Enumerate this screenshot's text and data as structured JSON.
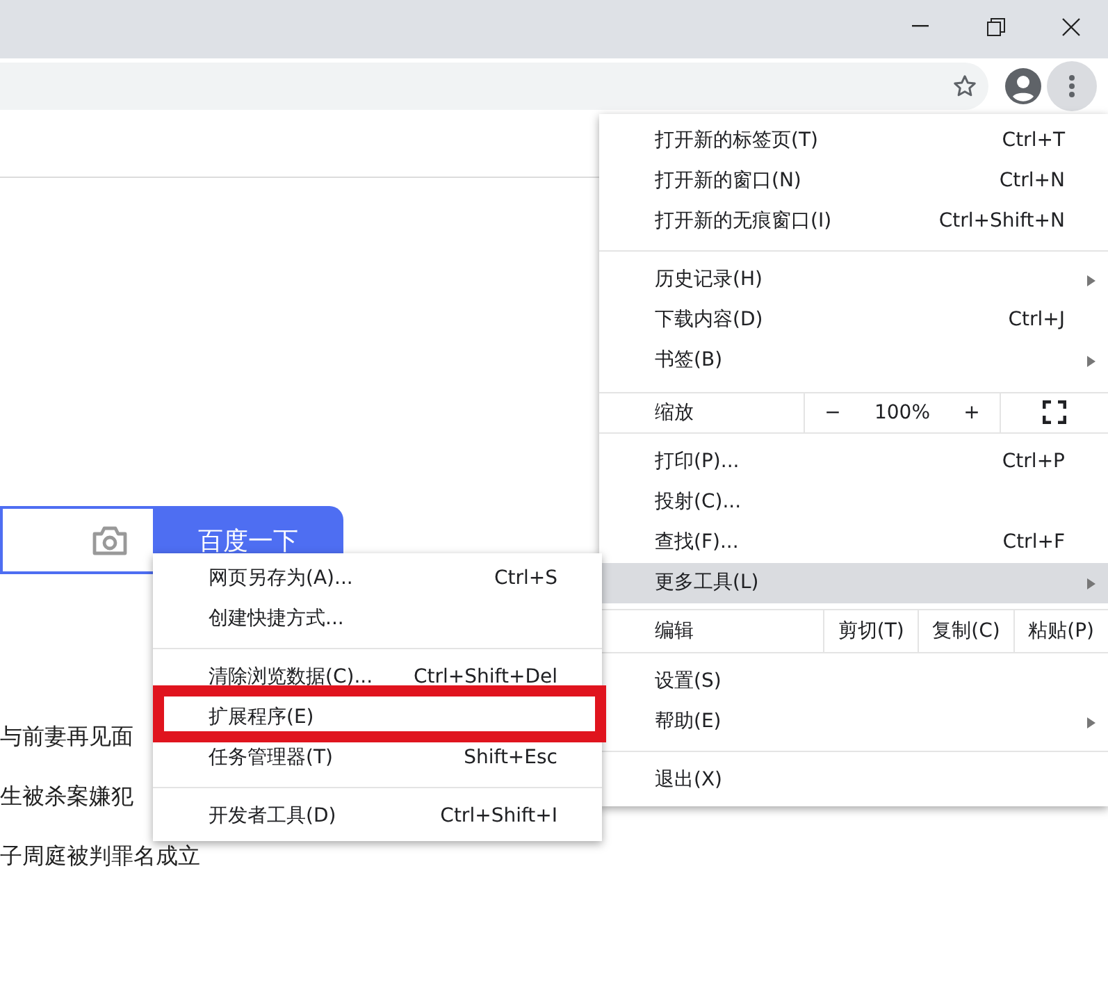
{
  "toolbar": {
    "menu_open": true
  },
  "page": {
    "search_button": "百度一下",
    "news": [
      "与前妻再见面",
      "生被杀案嫌犯",
      "子周庭被判罪名成立"
    ]
  },
  "main_menu": {
    "items": [
      {
        "kind": "item",
        "label": "打开新的标签页(T)",
        "shortcut": "Ctrl+T",
        "has_submenu": false,
        "selected": false
      },
      {
        "kind": "item",
        "label": "打开新的窗口(N)",
        "shortcut": "Ctrl+N",
        "has_submenu": false,
        "selected": false
      },
      {
        "kind": "item",
        "label": "打开新的无痕窗口(I)",
        "shortcut": "Ctrl+Shift+N",
        "has_submenu": false,
        "selected": false
      },
      {
        "kind": "separator"
      },
      {
        "kind": "item",
        "label": "历史记录(H)",
        "has_submenu": true,
        "selected": false
      },
      {
        "kind": "item",
        "label": "下载内容(D)",
        "shortcut": "Ctrl+J",
        "has_submenu": false,
        "selected": false
      },
      {
        "kind": "item",
        "label": "书签(B)",
        "has_submenu": true,
        "selected": false
      },
      {
        "kind": "zoom",
        "label": "缩放",
        "minus": "−",
        "value": "100%",
        "plus": "+"
      },
      {
        "kind": "item",
        "label": "打印(P)...",
        "shortcut": "Ctrl+P",
        "has_submenu": false,
        "selected": false
      },
      {
        "kind": "item",
        "label": "投射(C)...",
        "has_submenu": false,
        "selected": false
      },
      {
        "kind": "item",
        "label": "查找(F)...",
        "shortcut": "Ctrl+F",
        "has_submenu": false,
        "selected": false
      },
      {
        "kind": "item",
        "label": "更多工具(L)",
        "has_submenu": true,
        "selected": true
      },
      {
        "kind": "edit",
        "label": "编辑",
        "buttons": [
          "剪切(T)",
          "复制(C)",
          "粘贴(P)"
        ]
      },
      {
        "kind": "item",
        "label": "设置(S)",
        "has_submenu": false,
        "selected": false
      },
      {
        "kind": "item",
        "label": "帮助(E)",
        "has_submenu": true,
        "selected": false
      },
      {
        "kind": "separator"
      },
      {
        "kind": "item",
        "label": "退出(X)",
        "has_submenu": false,
        "selected": false
      }
    ]
  },
  "sub_menu": {
    "items": [
      {
        "kind": "item",
        "label": "网页另存为(A)...",
        "shortcut": "Ctrl+S",
        "highlighted": false
      },
      {
        "kind": "item",
        "label": "创建快捷方式...",
        "highlighted": false
      },
      {
        "kind": "separator"
      },
      {
        "kind": "item",
        "label": "清除浏览数据(C)...",
        "shortcut": "Ctrl+Shift+Del",
        "highlighted": false
      },
      {
        "kind": "item",
        "label": "扩展程序(E)",
        "highlighted": true
      },
      {
        "kind": "item",
        "label": "任务管理器(T)",
        "shortcut": "Shift+Esc",
        "highlighted": false
      },
      {
        "kind": "separator"
      },
      {
        "kind": "item",
        "label": "开发者工具(D)",
        "shortcut": "Ctrl+Shift+I",
        "highlighted": false
      }
    ]
  }
}
